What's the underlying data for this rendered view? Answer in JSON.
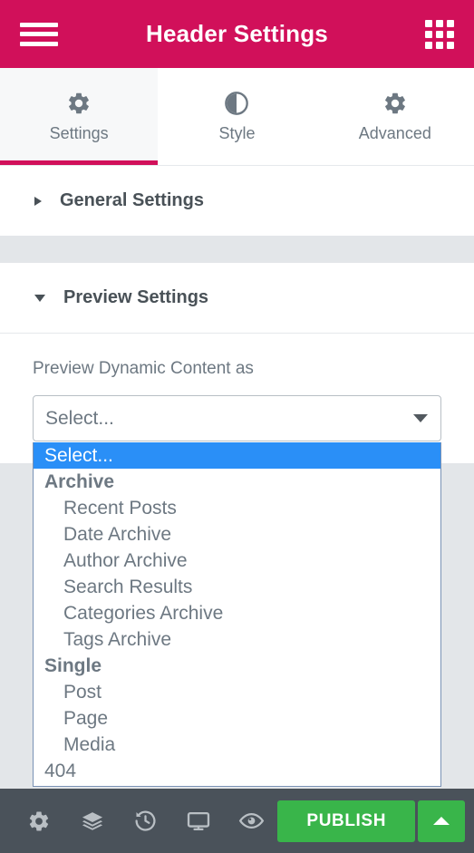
{
  "header": {
    "title": "Header Settings",
    "menu_icon": "hamburger-menu-icon",
    "grid_icon": "apps-grid-icon",
    "background_color": "#D1105A"
  },
  "tabs": [
    {
      "label": "Settings",
      "icon": "gear-icon",
      "active": true
    },
    {
      "label": "Style",
      "icon": "contrast-half-circle-icon",
      "active": false
    },
    {
      "label": "Advanced",
      "icon": "gear-icon",
      "active": false
    }
  ],
  "sections": [
    {
      "title": "General Settings",
      "expanded": false,
      "caret": "caret-right-icon"
    },
    {
      "title": "Preview Settings",
      "expanded": true,
      "caret": "caret-down-icon"
    }
  ],
  "preview_settings": {
    "field_label": "Preview Dynamic Content as",
    "select": {
      "value": "Select...",
      "placeholder": "Select...",
      "arrow_icon": "chevron-down-icon",
      "open": true,
      "options": [
        {
          "label": "Select...",
          "type": "option",
          "selected": true
        },
        {
          "label": "Archive",
          "type": "group"
        },
        {
          "label": "Recent Posts",
          "type": "child"
        },
        {
          "label": "Date Archive",
          "type": "child"
        },
        {
          "label": "Author Archive",
          "type": "child"
        },
        {
          "label": "Search Results",
          "type": "child"
        },
        {
          "label": "Categories Archive",
          "type": "child"
        },
        {
          "label": "Tags Archive",
          "type": "child"
        },
        {
          "label": "Single",
          "type": "group"
        },
        {
          "label": "Post",
          "type": "child"
        },
        {
          "label": "Page",
          "type": "child"
        },
        {
          "label": "Media",
          "type": "child"
        },
        {
          "label": "404",
          "type": "option"
        }
      ]
    }
  },
  "footer": {
    "icons": [
      {
        "name": "gear-icon",
        "title": "Settings"
      },
      {
        "name": "layers-icon",
        "title": "Navigator"
      },
      {
        "name": "history-icon",
        "title": "History"
      },
      {
        "name": "monitor-icon",
        "title": "Responsive Mode"
      },
      {
        "name": "eye-icon",
        "title": "Preview Changes"
      }
    ],
    "publish_label": "PUBLISH",
    "publish_color": "#39B54A",
    "publish_caret_icon": "caret-up-icon"
  },
  "colors": {
    "header_pink": "#D1105A",
    "panel_bg": "#E3E6E9",
    "highlight_blue": "#2A8FF7",
    "publish_green": "#39B54A",
    "footer_dark": "#4A525A",
    "text_gray": "#6D7882"
  }
}
